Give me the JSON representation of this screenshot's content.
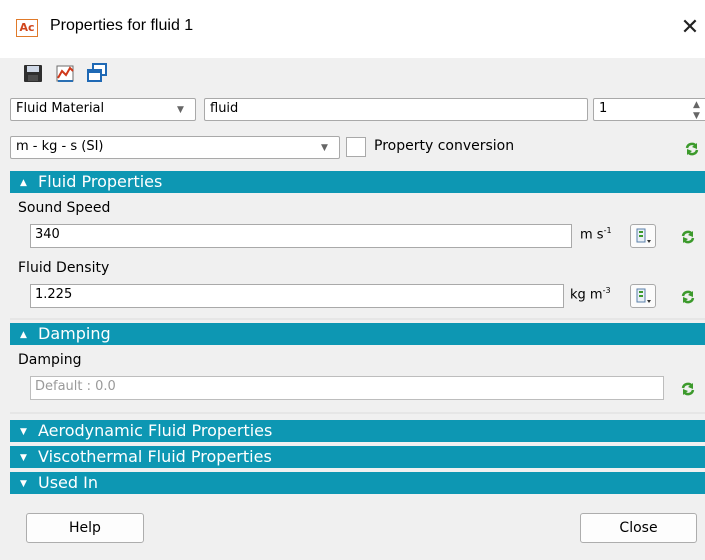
{
  "window": {
    "app_icon_text": "Ac",
    "title": "Properties for fluid 1",
    "close_glyph": "✕"
  },
  "toolbar": {
    "icons": [
      "save-icon",
      "chart-icon",
      "duplicate-windows-icon"
    ]
  },
  "row1": {
    "type_value": "Fluid Material",
    "name_value": "fluid",
    "id_value": "1"
  },
  "row2": {
    "units_value": "m - kg - s (SI)",
    "conversion_label": "Property conversion",
    "conversion_checked": false
  },
  "sections": {
    "fluid": {
      "title": "Fluid Properties",
      "sound_speed_label": "Sound Speed",
      "sound_speed_value": "340",
      "sound_speed_unit": "m s",
      "sound_speed_unit_exp": "-1",
      "density_label": "Fluid Density",
      "density_value": "1.225",
      "density_unit": "kg m",
      "density_unit_exp": "-3"
    },
    "damping": {
      "title": "Damping",
      "label": "Damping",
      "placeholder": "Default : 0.0"
    },
    "aero": {
      "title": "Aerodynamic Fluid Properties"
    },
    "visco": {
      "title": "Viscothermal Fluid Properties"
    },
    "used_in": {
      "title": "Used In"
    }
  },
  "footer": {
    "help_label": "Help",
    "close_label": "Close"
  },
  "colors": {
    "section_bg": "#0d97b3",
    "sync_green": "#3c9a2c",
    "accent_orange": "#e07a2a"
  }
}
